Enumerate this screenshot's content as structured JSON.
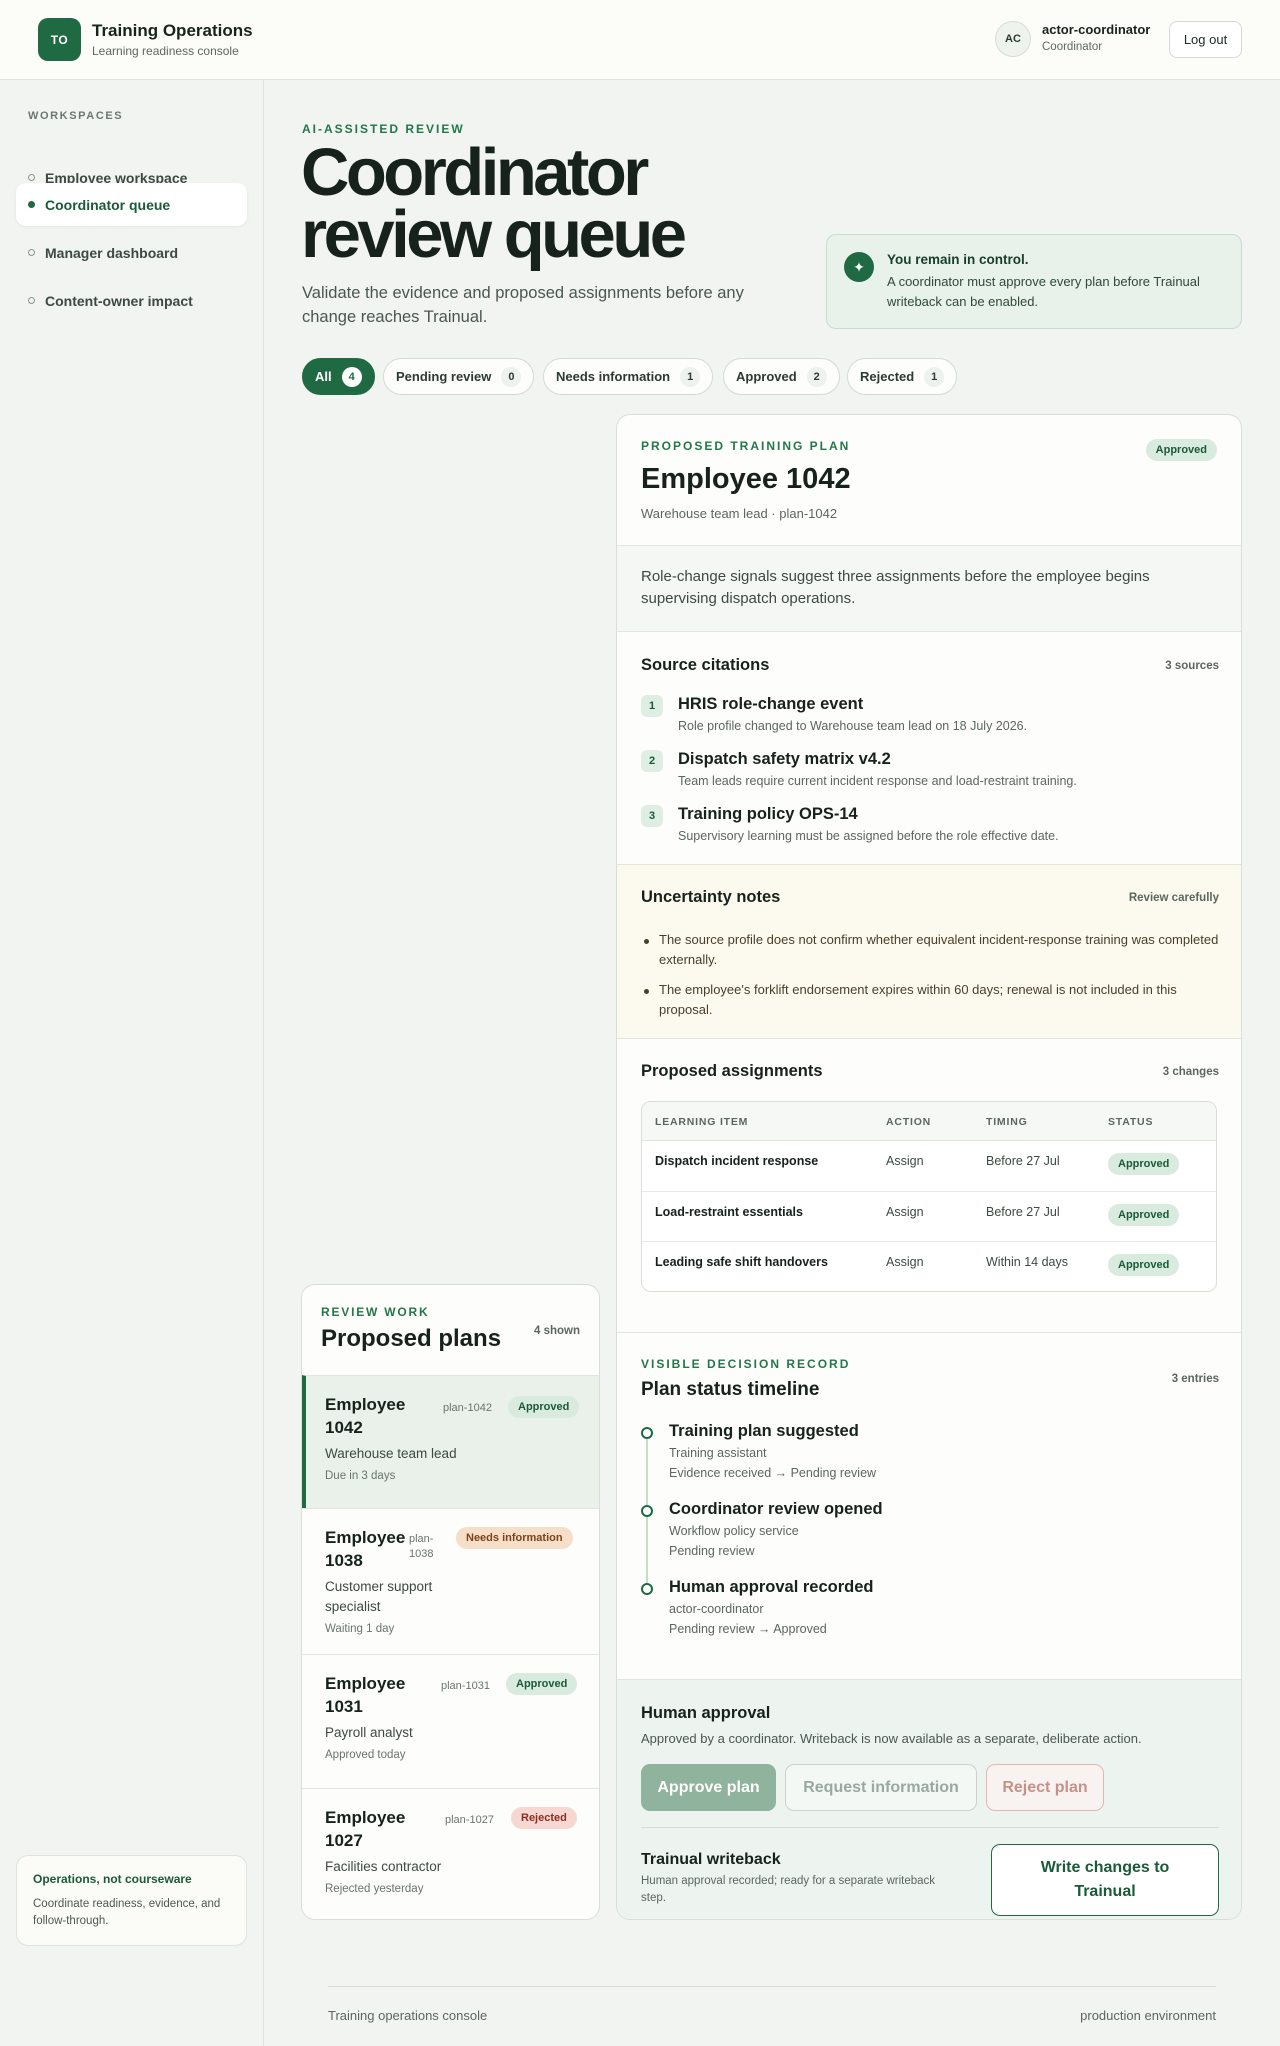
{
  "header": {
    "logo_text": "TO",
    "title": "Training Operations",
    "subtitle": "Learning readiness console",
    "avatar": "AC",
    "user_name": "actor-coordinator",
    "user_role": "Coordinator",
    "logout": "Log out"
  },
  "sidebar": {
    "heading": "WORKSPACES",
    "items": [
      {
        "label": "Employee workspace",
        "active": false
      },
      {
        "label": "Coordinator queue",
        "active": true
      },
      {
        "label": "Manager dashboard",
        "active": false
      },
      {
        "label": "Content-owner impact",
        "active": false
      }
    ],
    "card_title": "Operations, not courseware",
    "card_text": "Coordinate readiness, evidence, and follow-through."
  },
  "hero": {
    "eyebrow": "AI-ASSISTED REVIEW",
    "title": "Coordinator review queue",
    "subtitle": "Validate the evidence and proposed assignments before any change reaches Trainual.",
    "control_icon": "✦",
    "control_title": "You remain in control.",
    "control_text": "A coordinator must approve every plan before Trainual writeback can be enabled."
  },
  "filters": [
    {
      "label": "All",
      "count": "4",
      "active": true
    },
    {
      "label": "Pending review",
      "count": "0",
      "active": false
    },
    {
      "label": "Needs information",
      "count": "1",
      "active": false
    },
    {
      "label": "Approved",
      "count": "2",
      "active": false
    },
    {
      "label": "Rejected",
      "count": "1",
      "active": false
    }
  ],
  "plans": {
    "eyebrow": "REVIEW WORK",
    "title": "Proposed plans",
    "shown": "4 shown",
    "items": [
      {
        "name": "Employee 1042",
        "id": "plan-1042",
        "status": "Approved",
        "role": "Warehouse team lead",
        "due": "Due in 3 days"
      },
      {
        "name": "Employee 1038",
        "id": "plan-1038",
        "status": "Needs information",
        "role": "Customer support specialist",
        "due": "Waiting 1 day"
      },
      {
        "name": "Employee 1031",
        "id": "plan-1031",
        "status": "Approved",
        "role": "Payroll analyst",
        "due": "Approved today"
      },
      {
        "name": "Employee 1027",
        "id": "plan-1027",
        "status": "Rejected",
        "role": "Facilities contractor",
        "due": "Rejected yesterday"
      }
    ]
  },
  "detail": {
    "eyebrow": "PROPOSED TRAINING PLAN",
    "status": "Approved",
    "title": "Employee 1042",
    "subtitle": "Warehouse team lead · plan-1042",
    "summary": "Role-change signals suggest three assignments before the employee begins supervising dispatch operations.",
    "citations_title": "Source citations",
    "citations_meta": "3 sources",
    "citations": [
      {
        "num": "1",
        "title": "HRIS role-change event",
        "text": "Role profile changed to Warehouse team lead on 18 July 2026."
      },
      {
        "num": "2",
        "title": "Dispatch safety matrix v4.2",
        "text": "Team leads require current incident response and load-restraint training."
      },
      {
        "num": "3",
        "title": "Training policy OPS-14",
        "text": "Supervisory learning must be assigned before the role effective date."
      }
    ],
    "uncertainty_title": "Uncertainty notes",
    "uncertainty_meta": "Review carefully",
    "uncertainty": [
      "The source profile does not confirm whether equivalent incident-response training was completed externally.",
      "The employee's forklift endorsement expires within 60 days; renewal is not included in this proposal."
    ],
    "assignments_title": "Proposed assignments",
    "assignments_meta": "3 changes",
    "assignment_headers": [
      "LEARNING ITEM",
      "ACTION",
      "TIMING",
      "STATUS"
    ],
    "assignments": [
      {
        "item": "Dispatch incident response",
        "action": "Assign",
        "timing": "Before 27 Jul",
        "status": "Approved"
      },
      {
        "item": "Load-restraint essentials",
        "action": "Assign",
        "timing": "Before 27 Jul",
        "status": "Approved"
      },
      {
        "item": "Leading safe shift handovers",
        "action": "Assign",
        "timing": "Within 14 days",
        "status": "Approved"
      }
    ],
    "timeline_eyebrow": "VISIBLE DECISION RECORD",
    "timeline_title": "Plan status timeline",
    "timeline_meta": "3 entries",
    "timeline": [
      {
        "title": "Training plan suggested",
        "actor": "Training assistant",
        "transition": "Evidence received → Pending review"
      },
      {
        "title": "Coordinator review opened",
        "actor": "Workflow policy service",
        "transition": "Pending review"
      },
      {
        "title": "Human approval recorded",
        "actor": "actor-coordinator",
        "transition": "Pending review → Approved"
      }
    ],
    "approval_title": "Human approval",
    "approval_text": "Approved by a coordinator. Writeback is now available as a separate, deliberate action.",
    "btn_approve": "Approve plan",
    "btn_info": "Request information",
    "btn_reject": "Reject plan",
    "writeback_title": "Trainual writeback",
    "writeback_text": "Human approval recorded; ready for a separate writeback step.",
    "btn_write": "Write changes to Trainual"
  },
  "footer": {
    "left": "Training operations console",
    "right": "production environment"
  },
  "colors": {
    "brand": "#1f6a43",
    "background": "#f1f4f1",
    "approved_badge": "#d9ebde",
    "needs_badge": "#f6dec8",
    "rejected_badge": "#f6d7d2"
  }
}
